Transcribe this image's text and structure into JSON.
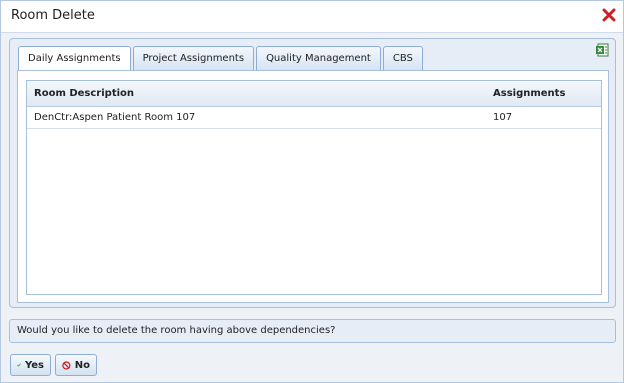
{
  "dialog": {
    "title": "Room Delete"
  },
  "tabs": [
    {
      "label": "Daily Assignments",
      "active": true
    },
    {
      "label": "Project Assignments",
      "active": false
    },
    {
      "label": "Quality Management",
      "active": false
    },
    {
      "label": "CBS",
      "active": false
    }
  ],
  "grid": {
    "columns": [
      "Room Description",
      "Assignments"
    ],
    "rows": [
      {
        "description": "DenCtr:Aspen Patient Room 107",
        "assignments": "107"
      }
    ]
  },
  "question": "Would you like to delete the room having above dependencies?",
  "buttons": {
    "yes_label": "Yes",
    "no_label": "No"
  },
  "icons": {
    "close": "close-icon",
    "export": "excel-export-icon",
    "yes": "checkmark-icon",
    "no": "prohibited-icon"
  },
  "colors": {
    "close_red": "#cc1f1f",
    "check_green": "#3a9a2a",
    "no_red": "#d11a1a",
    "panel_border": "#a6bfdc"
  }
}
